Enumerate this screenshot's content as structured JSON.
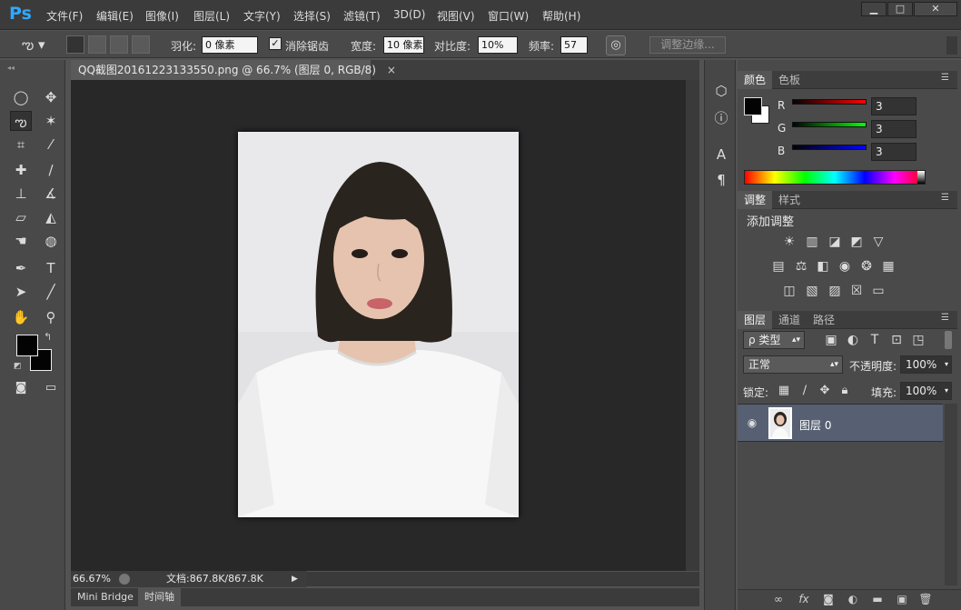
{
  "app": {
    "logo": "Ps"
  },
  "menu": [
    "文件(F)",
    "编辑(E)",
    "图像(I)",
    "图层(L)",
    "文字(Y)",
    "选择(S)",
    "滤镜(T)",
    "3D(D)",
    "视图(V)",
    "窗口(W)",
    "帮助(H)"
  ],
  "window_controls": {
    "minimize": "▁",
    "restore": "□",
    "close": "✕"
  },
  "options": {
    "feather_label": "羽化:",
    "feather_value": "0 像素",
    "antialias_label": "消除锯齿",
    "antialias_checked": "✓",
    "width_label": "宽度:",
    "width_value": "10 像素",
    "contrast_label": "对比度:",
    "contrast_value": "10%",
    "frequency_label": "频率:",
    "frequency_value": "57",
    "refine_edge_label": "调整边缘..."
  },
  "document": {
    "tab_title": "QQ截图20161223133550.png @ 66.7% (图层 0, RGB/8)",
    "tab_close": "×",
    "zoom": "66.67%",
    "doc_info": "文档:867.8K/867.8K",
    "photo_colors": {
      "background": "#e9e9ec",
      "hair": "#2a241e",
      "skin": "#e6c3ae",
      "shirt": "#f7f7f7",
      "lips": "#c8636a"
    }
  },
  "bottom_tabs": [
    "Mini Bridge",
    "时间轴"
  ],
  "color_panel": {
    "tabs": [
      "颜色",
      "色板"
    ],
    "r_label": "R",
    "g_label": "G",
    "b_label": "B",
    "r_value": "3",
    "g_value": "3",
    "b_value": "3",
    "foreground": "#030303",
    "background": "#ffffff"
  },
  "adjust_panel": {
    "tabs": [
      "调整",
      "样式"
    ],
    "heading": "添加调整"
  },
  "layers_panel": {
    "tabs": [
      "图层",
      "通道",
      "路径"
    ],
    "filter_label": "ρ 类型",
    "blend_mode": "正常",
    "opacity_label": "不透明度:",
    "opacity_value": "100%",
    "lock_label": "锁定:",
    "fill_label": "填充:",
    "fill_value": "100%",
    "layer_name": "图层 0"
  }
}
